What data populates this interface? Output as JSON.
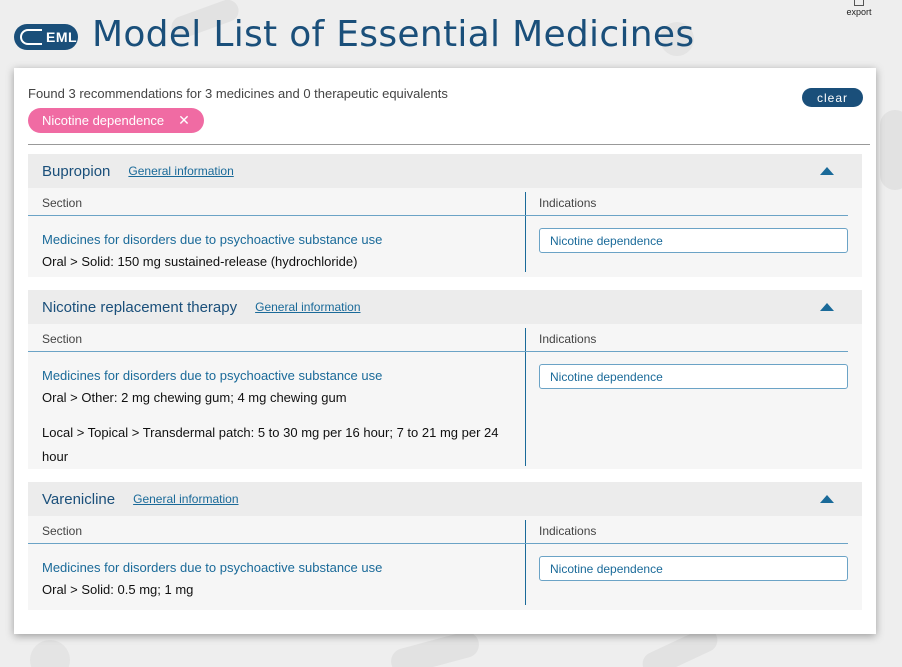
{
  "header": {
    "logo_text": "EML",
    "title": "Model List of Essential Medicines",
    "export_label": "export"
  },
  "search": {
    "summary": "Found 3 recommendations for 3 medicines and 0 therapeutic equivalents",
    "clear_label": "clear",
    "filter_chip": "Nicotine dependence",
    "chip_remove_glyph": "✕"
  },
  "table_headers": {
    "section": "Section",
    "indications": "Indications"
  },
  "general_info_label": "General information",
  "medicines": [
    {
      "name": "Bupropion",
      "section": "Medicines for disorders due to psychoactive substance use",
      "forms": [
        "Oral > Solid: 150 mg sustained-release (hydrochloride)"
      ],
      "indication": "Nicotine dependence"
    },
    {
      "name": "Nicotine replacement therapy",
      "section": "Medicines for disorders due to psychoactive substance use",
      "forms": [
        "Oral > Other: 2 mg chewing gum; 4 mg chewing gum",
        "Local > Topical > Transdermal patch: 5 to 30 mg per 16 hour; 7 to 21 mg per 24 hour"
      ],
      "indication": "Nicotine dependence"
    },
    {
      "name": "Varenicline",
      "section": "Medicines for disorders due to psychoactive substance use",
      "forms": [
        "Oral > Solid: 0.5 mg; 1 mg"
      ],
      "indication": "Nicotine dependence"
    }
  ],
  "colors": {
    "brand": "#1a4f7a",
    "link": "#1a6a99",
    "chip": "#f06ba3"
  },
  "icons": {
    "logo": "capsule-icon",
    "export": "export-icon",
    "collapse": "chevron-up-icon",
    "remove": "close-icon"
  }
}
